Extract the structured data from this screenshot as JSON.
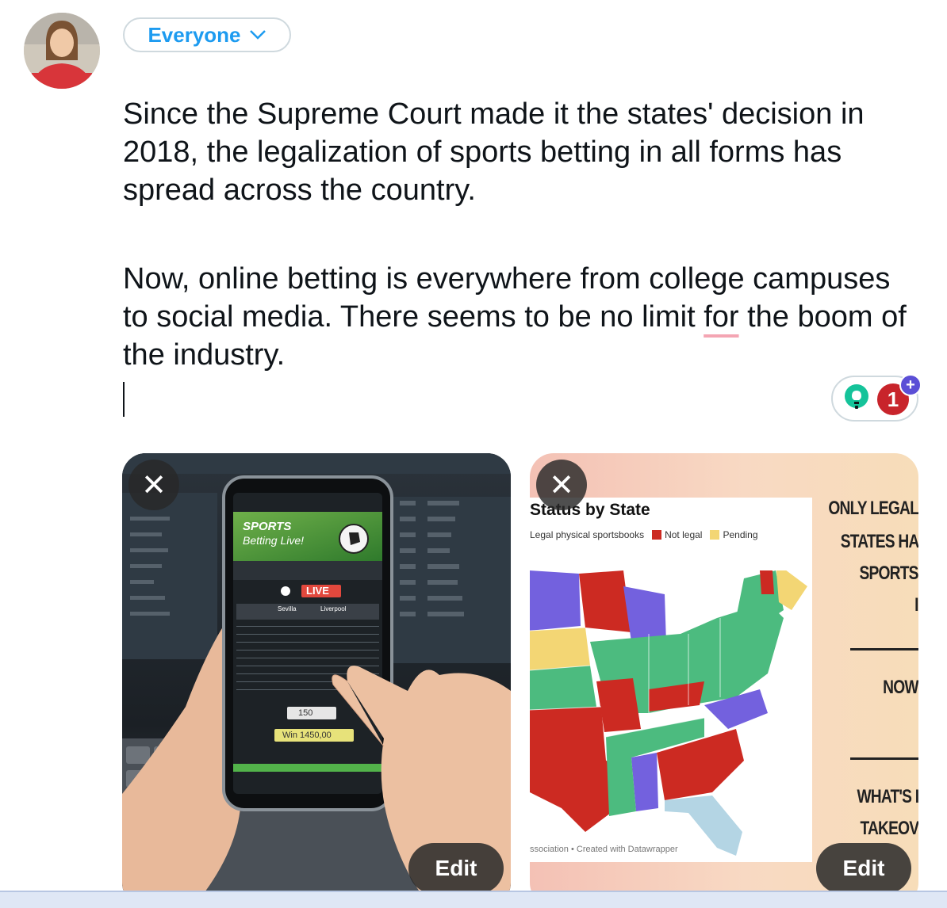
{
  "composer": {
    "audience_label": "Everyone",
    "paragraph1": "Since the Supreme Court made it the states' decision in 2018, the legalization of sports betting in all forms has spread across the country.",
    "paragraph2_pre": "Now, online betting is everywhere from college campuses to social media. There seems to be no limit ",
    "paragraph2_flagged": "for",
    "paragraph2_post": " the boom of the industry.",
    "assist_count": "1",
    "assist_plus": "+"
  },
  "media": {
    "close_symbol": "✕",
    "edit_label": "Edit",
    "phone": {
      "brand": "SPORTS",
      "brand2": "Betting Live!",
      "live_label": "LIVE",
      "team1": "Sevilla",
      "team2": "Liverpool",
      "stake": "150",
      "win": "Win  1450,00"
    },
    "map": {
      "title": "Status by State",
      "legend": [
        "Legal physical sportsbooks",
        "Not legal",
        "Pending"
      ],
      "credit": "ssociation • Created with Datawrapper",
      "side_lines": [
        "ONLY LEGAL",
        "STATES HA",
        "SPORTS",
        "I",
        "NOW",
        "WHAT'S I",
        "TAKEOV"
      ]
    }
  },
  "colors": {
    "accent": "#1d9bf0",
    "legal": "#4cbb7f",
    "not_legal": "#cc2a22",
    "pending": "#f3d674",
    "purple": "#7361de",
    "lightblue": "#b4d5e4"
  }
}
